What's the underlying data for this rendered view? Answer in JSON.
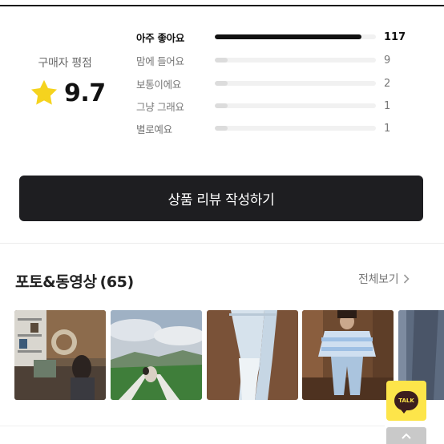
{
  "rating": {
    "label": "구매자 평점",
    "score": "9.7",
    "star_icon": "star-icon",
    "star_color": "#f5d31e",
    "distribution": [
      {
        "label": "아주 좋아요",
        "count": "117",
        "fraction": 0.91,
        "highlighted": true
      },
      {
        "label": "맘에 들어요",
        "count": "9",
        "fraction": 0.08,
        "highlighted": false
      },
      {
        "label": "보통이에요",
        "count": "2",
        "fraction": 0.08,
        "highlighted": false
      },
      {
        "label": "그냥 그래요",
        "count": "1",
        "fraction": 0.08,
        "highlighted": false
      },
      {
        "label": "별로예요",
        "count": "1",
        "fraction": 0.08,
        "highlighted": false
      }
    ]
  },
  "write_review": {
    "label": "상품 리뷰 작성하기"
  },
  "photos": {
    "title": "포토&동영상",
    "count": "(65)",
    "see_all": "전체보기",
    "see_all_icon": "chevron-right-icon"
  },
  "floating": {
    "talk_label": "TALK",
    "talk_color": "#fde54a",
    "scroll_top_icon": "chevron-up-icon"
  }
}
